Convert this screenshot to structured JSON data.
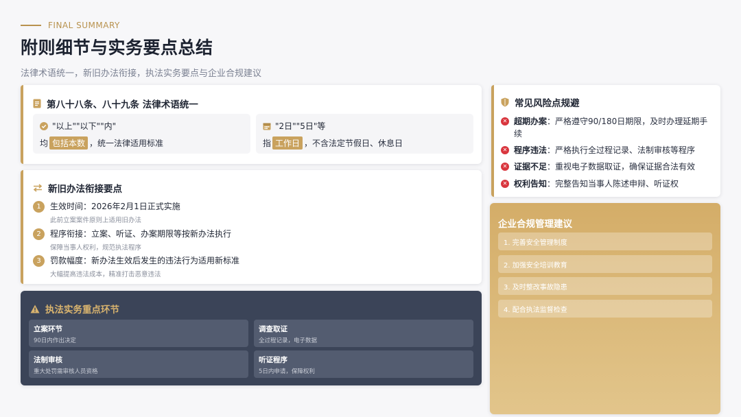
{
  "header": {
    "eyebrow": "FINAL SUMMARY",
    "title": "附则细节与实务要点总结",
    "subtitle": "法律术语统一，新旧办法衔接，执法实务要点与企业合规建议"
  },
  "terms_card": {
    "title": "第八十八条、八十九条 法律术语统一",
    "items": [
      {
        "head": "\"以上\"\"以下\"\"内\"",
        "pre": "均",
        "highlight": "包括本数",
        "post": "，统一法律适用标准"
      },
      {
        "head": "\"2日\"\"5日\"等",
        "pre": "指",
        "highlight": "工作日",
        "post": "，不含法定节假日、休息日"
      }
    ]
  },
  "transition_card": {
    "title": "新旧办法衔接要点",
    "steps": [
      {
        "num": "1",
        "main": "生效时间：2026年2月1日正式实施",
        "note": "此前立案案件原则上适用旧办法"
      },
      {
        "num": "2",
        "main": "程序衔接：立案、听证、办案期限等按新办法执行",
        "note": "保障当事人权利，规范执法程序"
      },
      {
        "num": "3",
        "main": "罚款幅度：新办法生效后发生的违法行为适用新标准",
        "note": "大幅提高违法成本，精准打击恶意违法"
      }
    ]
  },
  "practice_card": {
    "title": "执法实务重点环节",
    "tiles": [
      {
        "title": "立案环节",
        "sub": "90日内作出决定"
      },
      {
        "title": "调查取证",
        "sub": "全过程记录，电子数据"
      },
      {
        "title": "法制审核",
        "sub": "重大处罚需审核人员资格"
      },
      {
        "title": "听证程序",
        "sub": "5日内申请，保障权利"
      }
    ]
  },
  "risk_card": {
    "title": "常见风险点规避",
    "items": [
      {
        "label": "超期办案",
        "text": "：严格遵守90/180日期限，及时办理延期手续"
      },
      {
        "label": "程序违法",
        "text": "：严格执行全过程记录、法制审核等程序"
      },
      {
        "label": "证据不足",
        "text": "：重视电子数据取证，确保证据合法有效"
      },
      {
        "label": "权利告知",
        "text": "：完整告知当事人陈述申辩、听证权"
      }
    ]
  },
  "compliance_card": {
    "title": "企业合规管理建议",
    "items": [
      "1. 完善安全管理制度",
      "2. 加强安全培训教育",
      "3. 及时整改事故隐患",
      "4. 配合执法监督检查"
    ]
  },
  "colors": {
    "gold": "#c9a25e",
    "dark": "#3b4458",
    "danger": "#d9363e"
  },
  "icons": [
    "document-icon",
    "check-circle-icon",
    "calendar-icon",
    "swap-arrows-icon",
    "warning-icon",
    "shield-icon",
    "error-x-icon"
  ]
}
